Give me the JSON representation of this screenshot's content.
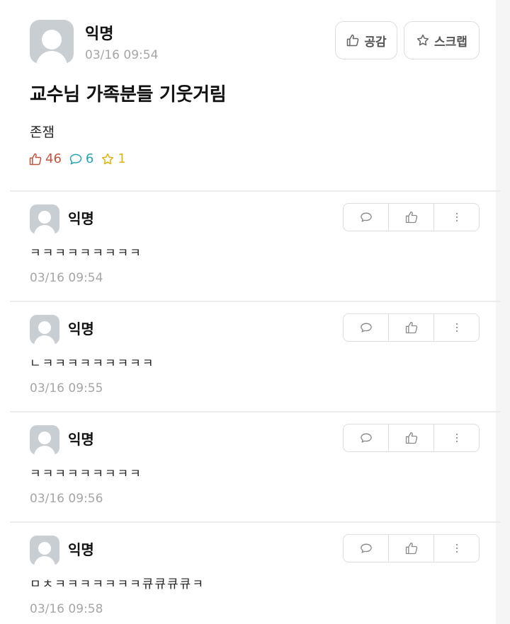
{
  "post": {
    "author": "익명",
    "time": "03/16 09:54",
    "like_button": "공감",
    "scrap_button": "스크랩",
    "title": "교수님 가족분들 기웃거림",
    "body": "존잼",
    "stats": {
      "likes": "46",
      "comments": "6",
      "scraps": "1"
    },
    "colors": {
      "like": "#c0543f",
      "comment": "#2aa1b8",
      "scrap": "#e0b314"
    }
  },
  "comments": [
    {
      "author": "익명",
      "text": "ㅋㅋㅋㅋㅋㅋㅋㅋㅋ",
      "time": "03/16 09:54"
    },
    {
      "author": "익명",
      "text": "ㄴㅋㅋㅋㅋㅋㅋㅋㅋㅋ",
      "time": "03/16 09:55"
    },
    {
      "author": "익명",
      "text": "ㅋㅋㅋㅋㅋㅋㅋㅋㅋ",
      "time": "03/16 09:56"
    },
    {
      "author": "익명",
      "text": "ㅁㅊㅋㅋㅋㅋㅋㅋㅋ큐큐큐큐ㅋ",
      "time": "03/16 09:58"
    }
  ],
  "icons": {
    "like": "thumbs-up-icon",
    "comment": "speech-bubble-icon",
    "scrap": "star-icon",
    "more": "more-vertical-icon",
    "avatar": "anonymous-avatar"
  }
}
